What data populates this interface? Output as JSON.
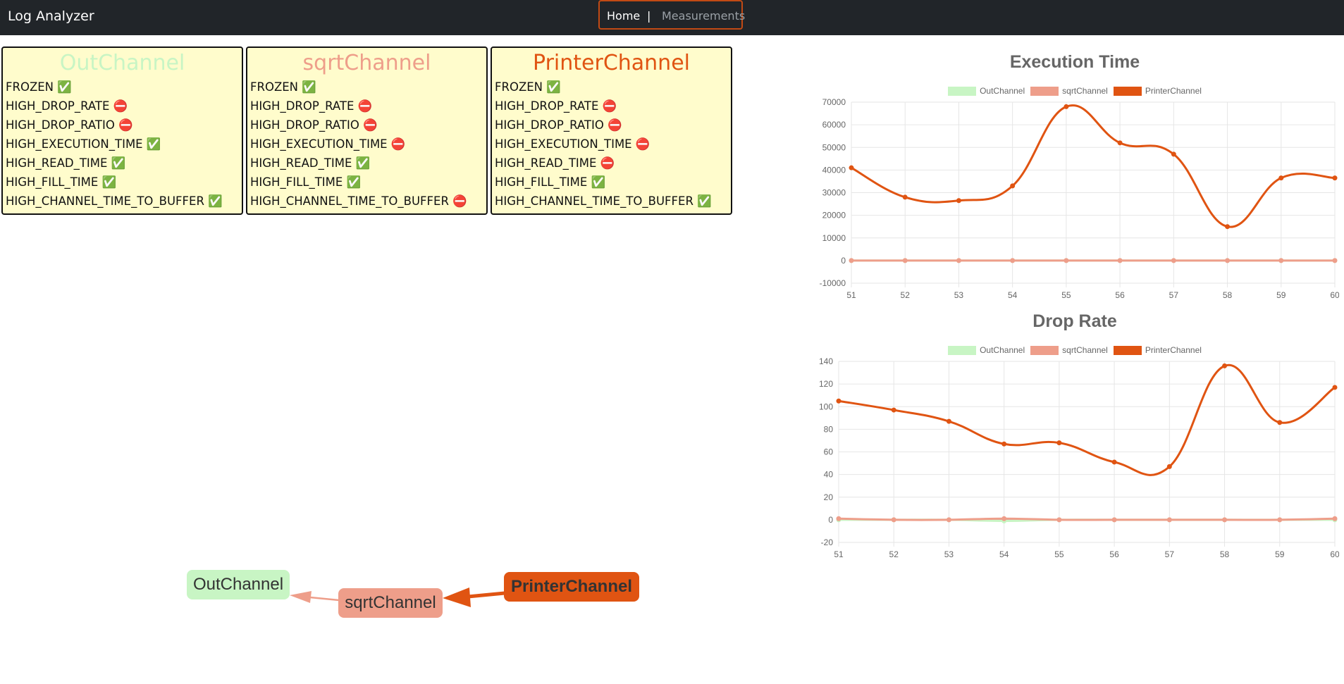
{
  "app": {
    "title": "Log Analyzer"
  },
  "nav": {
    "home": "Home",
    "separator": "|",
    "measurements": "Measurements"
  },
  "cards": [
    {
      "title": "OutChannel",
      "color": "#c8f5c4",
      "flags": [
        {
          "label": "FROZEN",
          "status": "✅"
        },
        {
          "label": "HIGH_DROP_RATE",
          "status": "⛔"
        },
        {
          "label": "HIGH_DROP_RATIO",
          "status": "⛔"
        },
        {
          "label": "HIGH_EXECUTION_TIME",
          "status": "✅"
        },
        {
          "label": "HIGH_READ_TIME",
          "status": "✅"
        },
        {
          "label": "HIGH_FILL_TIME",
          "status": "✅"
        },
        {
          "label": "HIGH_CHANNEL_TIME_TO_BUFFER",
          "status": "✅"
        }
      ]
    },
    {
      "title": "sqrtChannel",
      "color": "#ee9e8a",
      "flags": [
        {
          "label": "FROZEN",
          "status": "✅"
        },
        {
          "label": "HIGH_DROP_RATE",
          "status": "⛔"
        },
        {
          "label": "HIGH_DROP_RATIO",
          "status": "⛔"
        },
        {
          "label": "HIGH_EXECUTION_TIME",
          "status": "⛔"
        },
        {
          "label": "HIGH_READ_TIME",
          "status": "✅"
        },
        {
          "label": "HIGH_FILL_TIME",
          "status": "✅"
        },
        {
          "label": "HIGH_CHANNEL_TIME_TO_BUFFER",
          "status": "⛔"
        }
      ]
    },
    {
      "title": "PrinterChannel",
      "color": "#e05412",
      "flags": [
        {
          "label": "FROZEN",
          "status": "✅"
        },
        {
          "label": "HIGH_DROP_RATE",
          "status": "⛔"
        },
        {
          "label": "HIGH_DROP_RATIO",
          "status": "⛔"
        },
        {
          "label": "HIGH_EXECUTION_TIME",
          "status": "⛔"
        },
        {
          "label": "HIGH_READ_TIME",
          "status": "⛔"
        },
        {
          "label": "HIGH_FILL_TIME",
          "status": "✅"
        },
        {
          "label": "HIGH_CHANNEL_TIME_TO_BUFFER",
          "status": "✅"
        }
      ]
    }
  ],
  "graph": {
    "nodes": [
      {
        "label": "OutChannel",
        "color": "#c8f5c4",
        "bold": false
      },
      {
        "label": "sqrtChannel",
        "color": "#ee9e8a",
        "bold": false
      },
      {
        "label": "PrinterChannel",
        "color": "#e05412",
        "bold": true
      }
    ],
    "edges": [
      {
        "from": "PrinterChannel",
        "to": "sqrtChannel",
        "color": "#e05412"
      },
      {
        "from": "sqrtChannel",
        "to": "OutChannel",
        "color": "#ee9e8a"
      }
    ]
  },
  "chart_data": [
    {
      "type": "line",
      "title": "Execution Time",
      "x": [
        51,
        52,
        53,
        54,
        55,
        56,
        57,
        58,
        59,
        60
      ],
      "ylim": [
        -10000,
        70000
      ],
      "yticks": [
        -10000,
        0,
        10000,
        20000,
        30000,
        40000,
        50000,
        60000,
        70000
      ],
      "grid": true,
      "legend_position": "top",
      "series": [
        {
          "name": "OutChannel",
          "color": "#c8f5c4",
          "values": [
            0,
            0,
            0,
            0,
            0,
            0,
            0,
            0,
            0,
            0
          ]
        },
        {
          "name": "sqrtChannel",
          "color": "#ee9e8a",
          "values": [
            0,
            0,
            0,
            0,
            0,
            0,
            0,
            0,
            0,
            0
          ]
        },
        {
          "name": "PrinterChannel",
          "color": "#e05412",
          "values": [
            41000,
            28000,
            26500,
            33000,
            68000,
            52000,
            47000,
            15000,
            36500,
            36500
          ]
        }
      ]
    },
    {
      "type": "line",
      "title": "Drop Rate",
      "x": [
        51,
        52,
        53,
        54,
        55,
        56,
        57,
        58,
        59,
        60
      ],
      "ylim": [
        -20,
        140
      ],
      "yticks": [
        -20,
        0,
        20,
        40,
        60,
        80,
        100,
        120,
        140
      ],
      "grid": true,
      "legend_position": "top",
      "series": [
        {
          "name": "OutChannel",
          "color": "#c8f5c4",
          "values": [
            0,
            0,
            0,
            -1,
            0,
            0,
            0,
            0,
            0,
            0
          ]
        },
        {
          "name": "sqrtChannel",
          "color": "#ee9e8a",
          "values": [
            1,
            0,
            0,
            1,
            0,
            0,
            0,
            0,
            0,
            1
          ]
        },
        {
          "name": "PrinterChannel",
          "color": "#e05412",
          "values": [
            105,
            97,
            87,
            67,
            68,
            51,
            47,
            136,
            86,
            117
          ]
        }
      ]
    }
  ]
}
